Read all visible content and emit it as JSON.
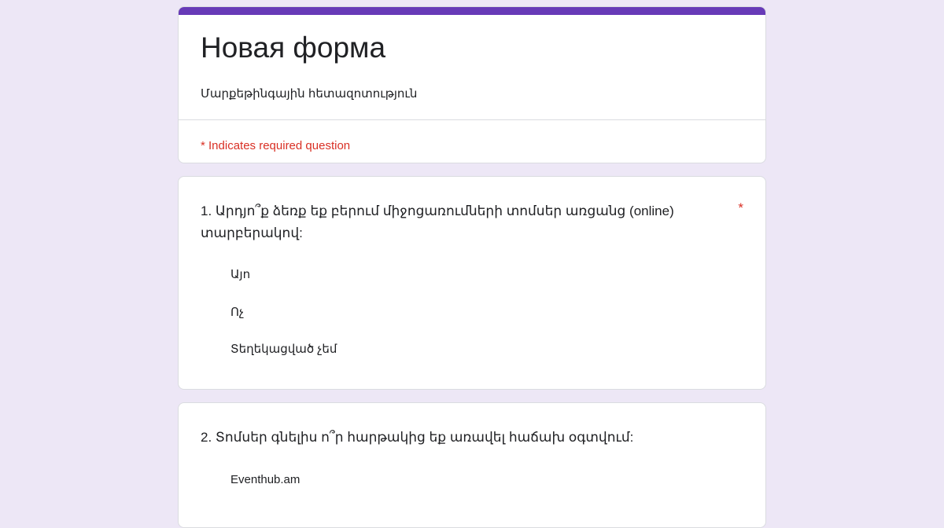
{
  "form": {
    "title": "Новая форма",
    "description": "Մարքեթինգային հետազոտություն",
    "required_note": "* Indicates required question",
    "accent_color": "#673ab7",
    "background_color": "#ede7f6",
    "required_color": "#d93025"
  },
  "questions": [
    {
      "text": "1. Արդյո՞ք ձեռք եք բերում միջոցառումների տոմսեր առցանց (online) տարբերակով:",
      "required_marker": "*",
      "options": [
        "Այո",
        "Ոչ",
        "Տեղեկացված չեմ"
      ]
    },
    {
      "text": "2. Տոմսեր գնելիս ո՞ր հարթակից եք առավել հաճախ օգտվում:",
      "options": [
        "Eventhub.am"
      ]
    }
  ]
}
